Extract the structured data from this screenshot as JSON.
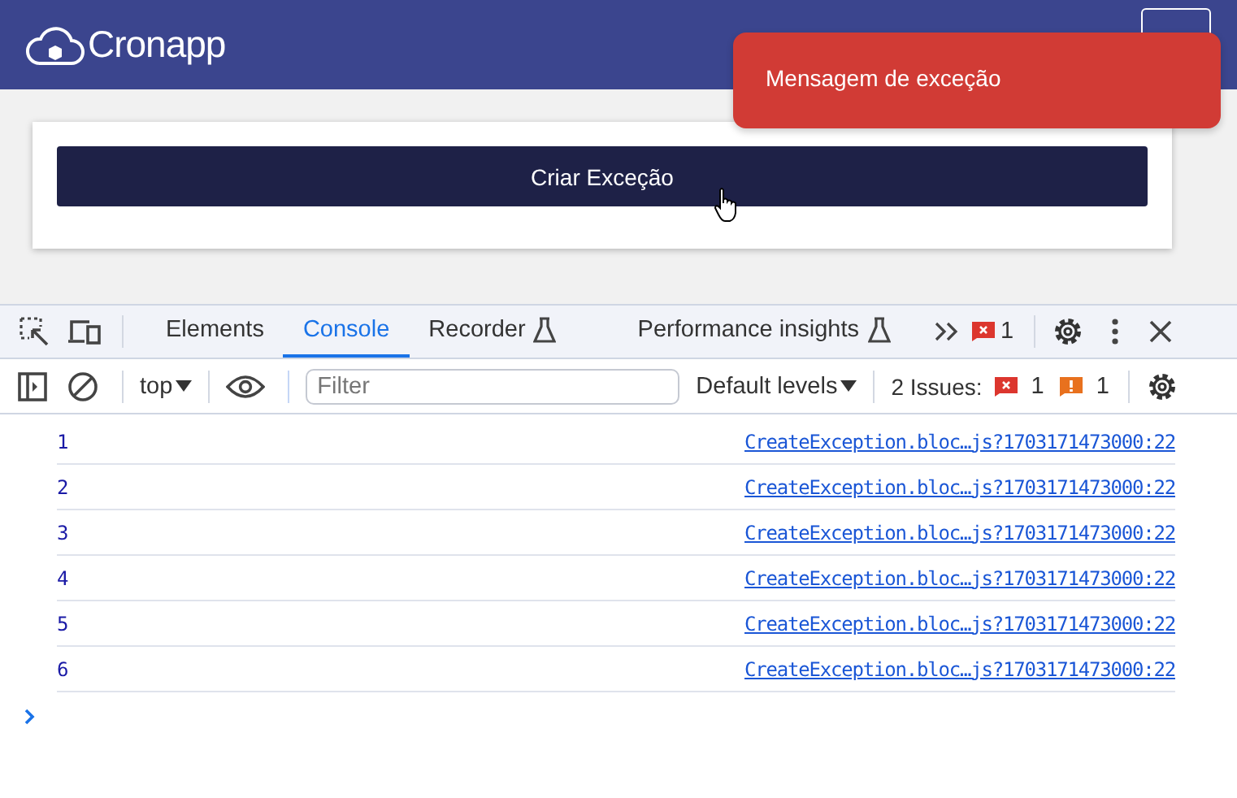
{
  "app": {
    "logo_text": "Cronapp"
  },
  "toast": {
    "message": "Mensagem de exceção"
  },
  "card": {
    "button": "Criar Exceção"
  },
  "devtools": {
    "tabs": [
      {
        "label": "Elements",
        "selected": false,
        "experimental": false
      },
      {
        "label": "Console",
        "selected": true,
        "experimental": false
      },
      {
        "label": "Recorder",
        "selected": false,
        "experimental": true
      },
      {
        "label": "Performance insights",
        "selected": false,
        "experimental": true
      }
    ],
    "error_count": "1",
    "toolbar": {
      "context": "top",
      "filter_placeholder": "Filter",
      "levels": "Default levels",
      "issues_label": "2 Issues:",
      "issue_errors": "1",
      "issue_warnings": "1"
    },
    "messages": [
      {
        "text": "1",
        "source": "CreateException.bloc…js?1703171473000:22"
      },
      {
        "text": "2",
        "source": "CreateException.bloc…js?1703171473000:22"
      },
      {
        "text": "3",
        "source": "CreateException.bloc…js?1703171473000:22"
      },
      {
        "text": "4",
        "source": "CreateException.bloc…js?1703171473000:22"
      },
      {
        "text": "5",
        "source": "CreateException.bloc…js?1703171473000:22"
      },
      {
        "text": "6",
        "source": "CreateException.bloc…js?1703171473000:22"
      }
    ]
  }
}
